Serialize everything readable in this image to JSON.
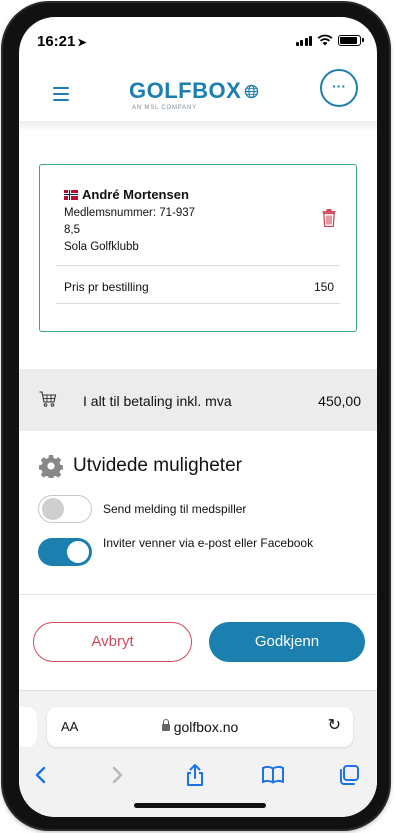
{
  "status_bar": {
    "time": "16:21",
    "location_arrow": "➤"
  },
  "header": {
    "logo_text": "GOLFBOX",
    "logo_tagline": "AN MSL COMPANY",
    "more_label": "···"
  },
  "player": {
    "name": "André Mortensen",
    "member_number": "Medlemsnummer: 71-937",
    "handicap": "8,5",
    "club": "Sola Golfklubb",
    "price_label": "Pris pr bestilling",
    "price_value": "150"
  },
  "total": {
    "label": "I alt til betaling inkl. mva",
    "value": "450,00"
  },
  "options": {
    "title": "Utvidede muligheter",
    "items": [
      {
        "label": "Send melding til medspiller",
        "enabled": false
      },
      {
        "label": "Inviter venner via e-post eller Facebook",
        "enabled": true
      }
    ]
  },
  "actions": {
    "cancel": "Avbryt",
    "approve": "Godkjenn"
  },
  "browser": {
    "text_size": "AA",
    "url": "golfbox.no"
  },
  "colors": {
    "brand_blue": "#1b7fb0",
    "card_border": "#3fa58a",
    "danger": "#d2485a"
  }
}
